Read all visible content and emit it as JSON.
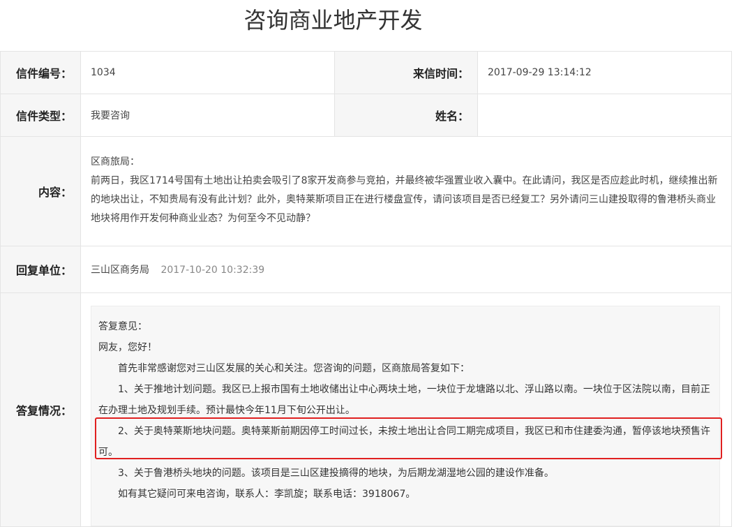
{
  "title": "咨询商业地产开发",
  "labels": {
    "letter_no": "信件编号：",
    "received_time": "来信时间：",
    "letter_type": "信件类型：",
    "name": "姓名：",
    "content": "内容：",
    "reply_unit": "回复单位：",
    "reply_status": "答复情况："
  },
  "values": {
    "letter_no": "1034",
    "received_time": "2017-09-29 13:14:12",
    "letter_type": "我要咨询",
    "name": "",
    "reply_unit": "三山区商务局",
    "reply_date": "2017-10-20 10:32:39"
  },
  "content": {
    "greeting": "区商旅局：",
    "body": "前两日，我区1714号国有土地出让拍卖会吸引了8家开发商参与竞拍，并最终被华强置业收入囊中。在此请问，我区是否应趁此时机，继续推出新的地块出让，不知贵局有没有此计划？此外，奥特莱斯项目正在进行楼盘宣传，请问该项目是否已经复工？另外请问三山建投取得的鲁港桥头商业地块将用作开发何种商业业态？为何至今不见动静？"
  },
  "answer": {
    "heading": "答复意见：",
    "salutation": "网友，您好！",
    "intro": "首先非常感谢您对三山区发展的关心和关注。您咨询的问题，区商旅局答复如下：",
    "p1": "1、关于推地计划问题。我区已上报市国有土地收储出让中心两块土地，一块位于龙塘路以北、浮山路以南。一块位于区法院以南，目前正在办理土地及规划手续。预计最快今年11月下旬公开出让。",
    "p2": "2、关于奥特莱斯地块问题。奥特莱斯前期因停工时间过长，未按土地出让合同工期完成项目，我区已和市住建委沟通，暂停该地块预售许可。",
    "p3": "3、关于鲁港桥头地块的问题。该项目是三山区建投摘得的地块，为后期龙湖湿地公园的建设作准备。",
    "contact": "如有其它疑问可来电咨询，联系人：李凯旋；联系电话：3918067。"
  }
}
